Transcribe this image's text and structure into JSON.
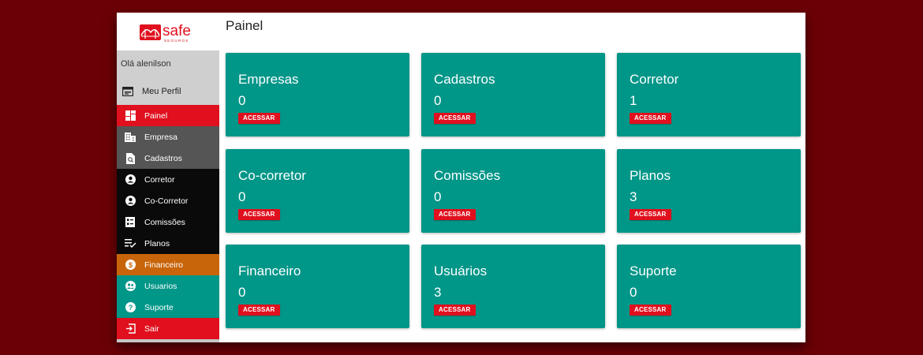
{
  "logo": {
    "text": "safe",
    "subtext": "SEGUROS",
    "color": "#e0101e"
  },
  "sidebar": {
    "greeting": "Olá alenilson",
    "profile": {
      "label": "Meu Perfil",
      "icon": "id-card-icon"
    },
    "items": [
      {
        "label": "Painel",
        "icon": "dashboard-icon",
        "bg": "#e0101e"
      },
      {
        "label": "Empresa",
        "icon": "building-icon",
        "bg": "#555555"
      },
      {
        "label": "Cadastros",
        "icon": "file-search-icon",
        "bg": "#555555"
      },
      {
        "label": "Corretor",
        "icon": "user-circle-icon",
        "bg": "#0a0a0a"
      },
      {
        "label": "Co-Corretor",
        "icon": "user-circle-icon",
        "bg": "#0a0a0a"
      },
      {
        "label": "Comissões",
        "icon": "list-box-icon",
        "bg": "#0a0a0a"
      },
      {
        "label": "Planos",
        "icon": "playlist-check-icon",
        "bg": "#0a0a0a"
      },
      {
        "label": "Financeiro",
        "icon": "dollar-circle-icon",
        "bg": "#c8650a"
      },
      {
        "label": "Usuarios",
        "icon": "users-circle-icon",
        "bg": "#009688"
      },
      {
        "label": "Suporte",
        "icon": "help-circle-icon",
        "bg": "#009688"
      },
      {
        "label": "Sair",
        "icon": "exit-icon",
        "bg": "#e0101e"
      }
    ]
  },
  "main": {
    "title": "Painel",
    "card_color": "#009688",
    "cards": [
      {
        "title": "Empresas",
        "count": "0",
        "button": "ACESSAR"
      },
      {
        "title": "Cadastros",
        "count": "0",
        "button": "ACESSAR"
      },
      {
        "title": "Corretor",
        "count": "1",
        "button": "ACESSAR"
      },
      {
        "title": "Co-corretor",
        "count": "0",
        "button": "ACESSAR"
      },
      {
        "title": "Comissões",
        "count": "0",
        "button": "ACESSAR"
      },
      {
        "title": "Planos",
        "count": "3",
        "button": "ACESSAR"
      },
      {
        "title": "Financeiro",
        "count": "0",
        "button": "ACESSAR"
      },
      {
        "title": "Usuários",
        "count": "3",
        "button": "ACESSAR"
      },
      {
        "title": "Suporte",
        "count": "0",
        "button": "ACESSAR"
      }
    ]
  }
}
